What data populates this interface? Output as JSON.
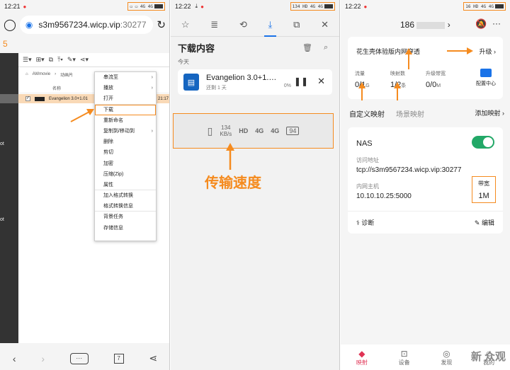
{
  "panel1": {
    "status_time": "12:21",
    "url_host": "s3m9567234.wicp.vip",
    "url_port": ":30277",
    "partial_num": "5",
    "breadcrumb": [
      "AWmovie",
      "动画片"
    ],
    "column_name": "名称",
    "file_row": {
      "name": "Evangelion 3.0+1.01",
      "time": "21:17"
    },
    "side_labels": [
      "ot",
      "ot"
    ],
    "context_menu": [
      {
        "label": "串流至",
        "arrow": true
      },
      {
        "label": "播放",
        "arrow": true
      },
      {
        "label": "打开",
        "arrow": false
      },
      {
        "label": "下载",
        "arrow": false,
        "selected": true
      },
      {
        "label": "重新命名",
        "arrow": false
      },
      {
        "label": "复制到/移动到",
        "arrow": true
      },
      {
        "label": "删除",
        "arrow": false
      },
      {
        "label": "剪切",
        "arrow": false
      },
      {
        "label": "加密",
        "arrow": false
      },
      {
        "label": "压缩(Zip)",
        "arrow": false
      },
      {
        "label": "属性",
        "arrow": false
      },
      {
        "label": "加入格式转换",
        "arrow": false
      },
      {
        "label": "格式转换信息",
        "arrow": false
      },
      {
        "label": "背景任务",
        "arrow": false
      },
      {
        "label": "存储信息",
        "arrow": false
      }
    ],
    "tab_count": "7",
    "more": "···"
  },
  "panel2": {
    "status_time": "12:22",
    "title": "下载内容",
    "section_label": "今天",
    "download": {
      "name": "Evangelion 3.0+1.…",
      "remaining": "还剩 1 天",
      "percent": "0%"
    },
    "speed": {
      "value": "134",
      "unit": "KB/s",
      "hd": "HD",
      "net1": "4G",
      "net2": "4G",
      "battery": "94"
    },
    "annotation": "传输速度"
  },
  "panel3": {
    "status_time": "12:22",
    "device_prefix": "186",
    "card_title": "花生壳体验版内网穿透",
    "upgrade": "升级",
    "stats": [
      {
        "label": "流量",
        "value": "0/1",
        "unit": "G"
      },
      {
        "label": "映射数",
        "value": "1/2",
        "unit": "条"
      },
      {
        "label": "升级带宽",
        "value": "0/0",
        "unit": "M"
      }
    ],
    "config_center": "配置中心",
    "tab_custom": "自定义映射",
    "tab_scene": "场景映射",
    "add_mapping": "添加映射",
    "mapping": {
      "name": "NAS",
      "access_label": "访问地址",
      "access_value": "tcp://s3m9567234.wicp.vip:30277",
      "host_label": "内网主机",
      "host_value": "10.10.10.25:5000",
      "bw_label": "带宽",
      "bw_value": "1M",
      "diagnose": "诊断",
      "edit": "编辑"
    },
    "nav": [
      {
        "icon": "mapping-icon",
        "label": "映射",
        "active": true
      },
      {
        "icon": "device-icon",
        "label": "设备",
        "active": false
      },
      {
        "icon": "discover-icon",
        "label": "发现",
        "active": false
      },
      {
        "icon": "profile-icon",
        "label": "我的",
        "active": false
      }
    ],
    "watermark": "新 众观"
  },
  "colors": {
    "accent_orange": "#f58b1f",
    "link_blue": "#1a73e8",
    "toggle_green": "#22a867",
    "nav_active": "#e03355"
  }
}
